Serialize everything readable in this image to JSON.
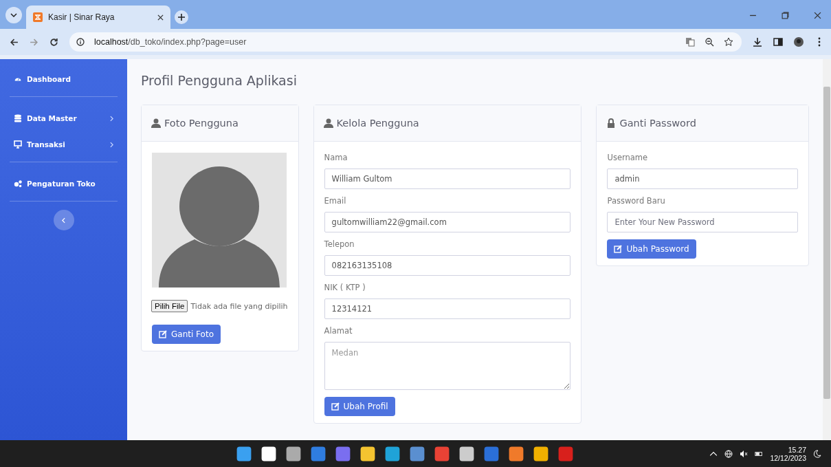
{
  "browser": {
    "tab_title": "Kasir | Sinar Raya",
    "url_host": "localhost",
    "url_path": "/db_toko/index.php?page=user"
  },
  "sidebar": {
    "items": [
      {
        "label": "Dashboard",
        "kind": "link"
      },
      {
        "label": "Data Master",
        "kind": "menu"
      },
      {
        "label": "Transaksi",
        "kind": "menu"
      },
      {
        "label": "Pengaturan Toko",
        "kind": "link"
      }
    ]
  },
  "page_title": "Profil Pengguna Aplikasi",
  "photo_card": {
    "title": "Foto Pengguna",
    "file_button": "Pilih File",
    "file_status": "Tidak ada file yang dipilih",
    "button": "Ganti Foto"
  },
  "profile_card": {
    "title": "Kelola Pengguna",
    "fields": [
      {
        "label": "Nama",
        "value": "William Gultom",
        "kind": "input"
      },
      {
        "label": "Email",
        "value": "gultomwilliam22@gmail.com",
        "kind": "input"
      },
      {
        "label": "Telepon",
        "value": "082163135108",
        "kind": "input"
      },
      {
        "label": "NIK ( KTP )",
        "value": "12314121",
        "kind": "input"
      },
      {
        "label": "Alamat",
        "placeholder": "Medan",
        "kind": "textarea"
      }
    ],
    "button": "Ubah Profil"
  },
  "password_card": {
    "title": "Ganti Password",
    "fields": [
      {
        "label": "Username",
        "value": "admin"
      },
      {
        "label": "Password Baru",
        "placeholder": "Enter Your New Password"
      }
    ],
    "button": "Ubah Password"
  },
  "taskbar": {
    "time": "15.27",
    "date": "12/12/2023"
  }
}
